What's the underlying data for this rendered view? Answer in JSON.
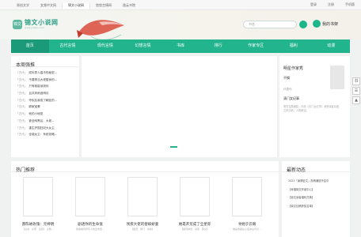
{
  "topbar": {
    "links": [
      "原创文学",
      "女频中文网",
      "锦文小说网",
      "悠悠言情网",
      "逸云书院"
    ],
    "active_index": 2,
    "right": [
      "登录",
      "注册",
      "手机版"
    ]
  },
  "header": {
    "logo_badge": "锦文",
    "logo_name": "锦文小说网",
    "logo_url": "www.jinwen.com",
    "search_placeholder": "书名",
    "shelf_label": "我的书架"
  },
  "nav": [
    "首页",
    "古代言情",
    "现代言情",
    "幻想言情",
    "书库",
    "排行",
    "作家专区",
    "福利",
    "动漫"
  ],
  "nav_active": 0,
  "rank": {
    "title": "本周强推",
    "items": [
      {
        "cat": "「古代」",
        "title": "成年男人高冷的秘密..."
      },
      {
        "cat": "「古代」",
        "title": "不要再当大佬替身的..."
      },
      {
        "cat": "「古代」",
        "title": "只有我能读到你"
      },
      {
        "cat": "「古代」",
        "title": "且共风雨逐明月"
      },
      {
        "cat": "「古代」",
        "title": "夺权后我成了朝廷的..."
      },
      {
        "cat": "「古代」",
        "title": "卿家宝妻"
      },
      {
        "cat": "「古代」",
        "title": "他的小秘密"
      },
      {
        "cat": "「古代」",
        "title": "被全网黑后，大佬..."
      },
      {
        "cat": "「古代」",
        "title": "重生护国狂妃大女主"
      },
      {
        "cat": "「古代」",
        "title": "全能女主：系统攻略..."
      }
    ]
  },
  "author": {
    "heading": "明星作家秀",
    "name": "不搁",
    "works_label": "代表作",
    "book": "清门女纪事",
    "desc": "笔墨温柔细腻，作品《清门女纪事》深受读者喜爱，文风清新，人物鲜活。"
  },
  "hot": {
    "title": "热门推荐",
    "books": [
      {
        "title": "愿陈故玫瑰：元婷明",
        "sub": "【古言 · 女尊 · 宫廷】 主角…"
      },
      {
        "title": "剧透你的生命值",
        "sub": "我能看到所有人的生命值…"
      },
      {
        "title": "残疾大佬的替嫁娇妻",
        "sub": "【甜宠 · 豪门 · 替嫁】"
      },
      {
        "title": "她靠开荒成了全星际",
        "sub": "【星际种田 · 基建 · 爽文】"
      },
      {
        "title": "寻她于云端",
        "sub": "她是他藏在心底的白月光…"
      }
    ]
  },
  "news": {
    "title": "最新动态",
    "items": [
      "2023「暑期征文」投稿通道开启中",
      "【幸福锦文作者中心】",
      "【锦文读者福利兑换】",
      "【锦文征稿获奖名单】"
    ]
  },
  "side_tools": [
    "书",
    "☰",
    "▲"
  ]
}
